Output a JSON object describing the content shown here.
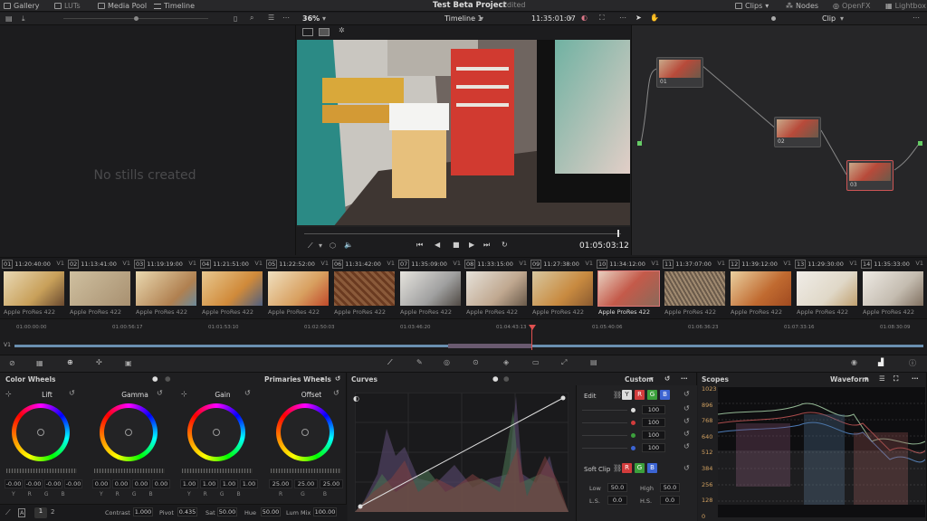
{
  "topbar": {
    "gallery": "Gallery",
    "luts": "LUTs",
    "media_pool": "Media Pool",
    "timeline": "Timeline",
    "project": "Test Beta Project",
    "status": "Edited",
    "clips": "Clips",
    "nodes": "Nodes",
    "openfx": "OpenFX",
    "lightbox": "Lightbox"
  },
  "viewer": {
    "zoom": "36%",
    "timeline_name": "Timeline 1",
    "timecode": "11:35:01:07",
    "playhead": "01:05:03:12"
  },
  "nodes_panel": {
    "mode": "Clip",
    "nodes": [
      {
        "id": "01"
      },
      {
        "id": "02"
      },
      {
        "id": "03"
      }
    ]
  },
  "gallery": {
    "empty": "No stills created"
  },
  "clips": [
    {
      "n": "01",
      "tc": "11:20:40:00",
      "track": "V1",
      "codec": "Apple ProRes 422"
    },
    {
      "n": "02",
      "tc": "11:13:41:00",
      "track": "V1",
      "codec": "Apple ProRes 422"
    },
    {
      "n": "03",
      "tc": "11:19:19:00",
      "track": "V1",
      "codec": "Apple ProRes 422"
    },
    {
      "n": "04",
      "tc": "11:21:51:00",
      "track": "V1",
      "codec": "Apple ProRes 422"
    },
    {
      "n": "05",
      "tc": "11:22:52:00",
      "track": "V1",
      "codec": "Apple ProRes 422"
    },
    {
      "n": "06",
      "tc": "11:31:42:00",
      "track": "V1",
      "codec": "Apple ProRes 422"
    },
    {
      "n": "07",
      "tc": "11:35:09:00",
      "track": "V1",
      "codec": "Apple ProRes 422"
    },
    {
      "n": "08",
      "tc": "11:33:15:00",
      "track": "V1",
      "codec": "Apple ProRes 422"
    },
    {
      "n": "09",
      "tc": "11:27:38:00",
      "track": "V1",
      "codec": "Apple ProRes 422"
    },
    {
      "n": "10",
      "tc": "11:34:12:00",
      "track": "V1",
      "codec": "Apple ProRes 422"
    },
    {
      "n": "11",
      "tc": "11:37:07:00",
      "track": "V1",
      "codec": "Apple ProRes 422"
    },
    {
      "n": "12",
      "tc": "11:39:12:00",
      "track": "V1",
      "codec": "Apple ProRes 422"
    },
    {
      "n": "13",
      "tc": "11:29:30:00",
      "track": "V1",
      "codec": "Apple ProRes 422"
    },
    {
      "n": "14",
      "tc": "11:35:33:00",
      "track": "V1",
      "codec": "Apple ProRes 422"
    }
  ],
  "timeline": {
    "track": "V1",
    "ruler": [
      "01:00:00:00",
      "01:00:56:17",
      "01:01:53:10",
      "01:02:50:03",
      "01:03:46:20",
      "01:04:43:13",
      "01:05:40:06",
      "01:06:36:23",
      "01:07:33:16",
      "01:08:30:09"
    ]
  },
  "color_wheels": {
    "title": "Color Wheels",
    "mode": "Primaries Wheels",
    "wheels": [
      {
        "name": "Lift",
        "vals": [
          "-0.00",
          "-0.00",
          "-0.00",
          "-0.00"
        ]
      },
      {
        "name": "Gamma",
        "vals": [
          "0.00",
          "0.00",
          "0.00",
          "0.00"
        ]
      },
      {
        "name": "Gain",
        "vals": [
          "1.00",
          "1.00",
          "1.00",
          "1.00"
        ]
      },
      {
        "name": "Offset",
        "vals": [
          "25.00",
          "25.00",
          "25.00"
        ]
      }
    ],
    "ch4": [
      "Y",
      "R",
      "G",
      "B"
    ],
    "ch3": [
      "R",
      "G",
      "B"
    ]
  },
  "footer": {
    "page1": "1",
    "page2": "2",
    "contrast_label": "Contrast",
    "contrast": "1.000",
    "pivot_label": "Pivot",
    "pivot": "0.435",
    "sat_label": "Sat",
    "sat": "50.00",
    "hue_label": "Hue",
    "hue": "50.00",
    "lummix_label": "Lum Mix",
    "lummix": "100.00"
  },
  "curves": {
    "title": "Curves",
    "mode": "Custom",
    "edit": "Edit",
    "ch_vals": [
      "100",
      "100",
      "100",
      "100"
    ],
    "soft_clip": "Soft Clip",
    "low_label": "Low",
    "low": "50.0",
    "high_label": "High",
    "high": "50.0",
    "ls_label": "L.S.",
    "ls": "0.0",
    "hs_label": "H.S.",
    "hs": "0.0",
    "buttons": [
      "Y",
      "R",
      "G",
      "B"
    ]
  },
  "scopes": {
    "title": "Scopes",
    "mode": "Waveform",
    "scale": [
      "1023",
      "896",
      "768",
      "640",
      "512",
      "384",
      "256",
      "128",
      "0"
    ]
  },
  "colors": {
    "accent": "#e05050",
    "red": "#d23c3c",
    "green": "#3ca03c",
    "blue": "#3c64d2"
  }
}
